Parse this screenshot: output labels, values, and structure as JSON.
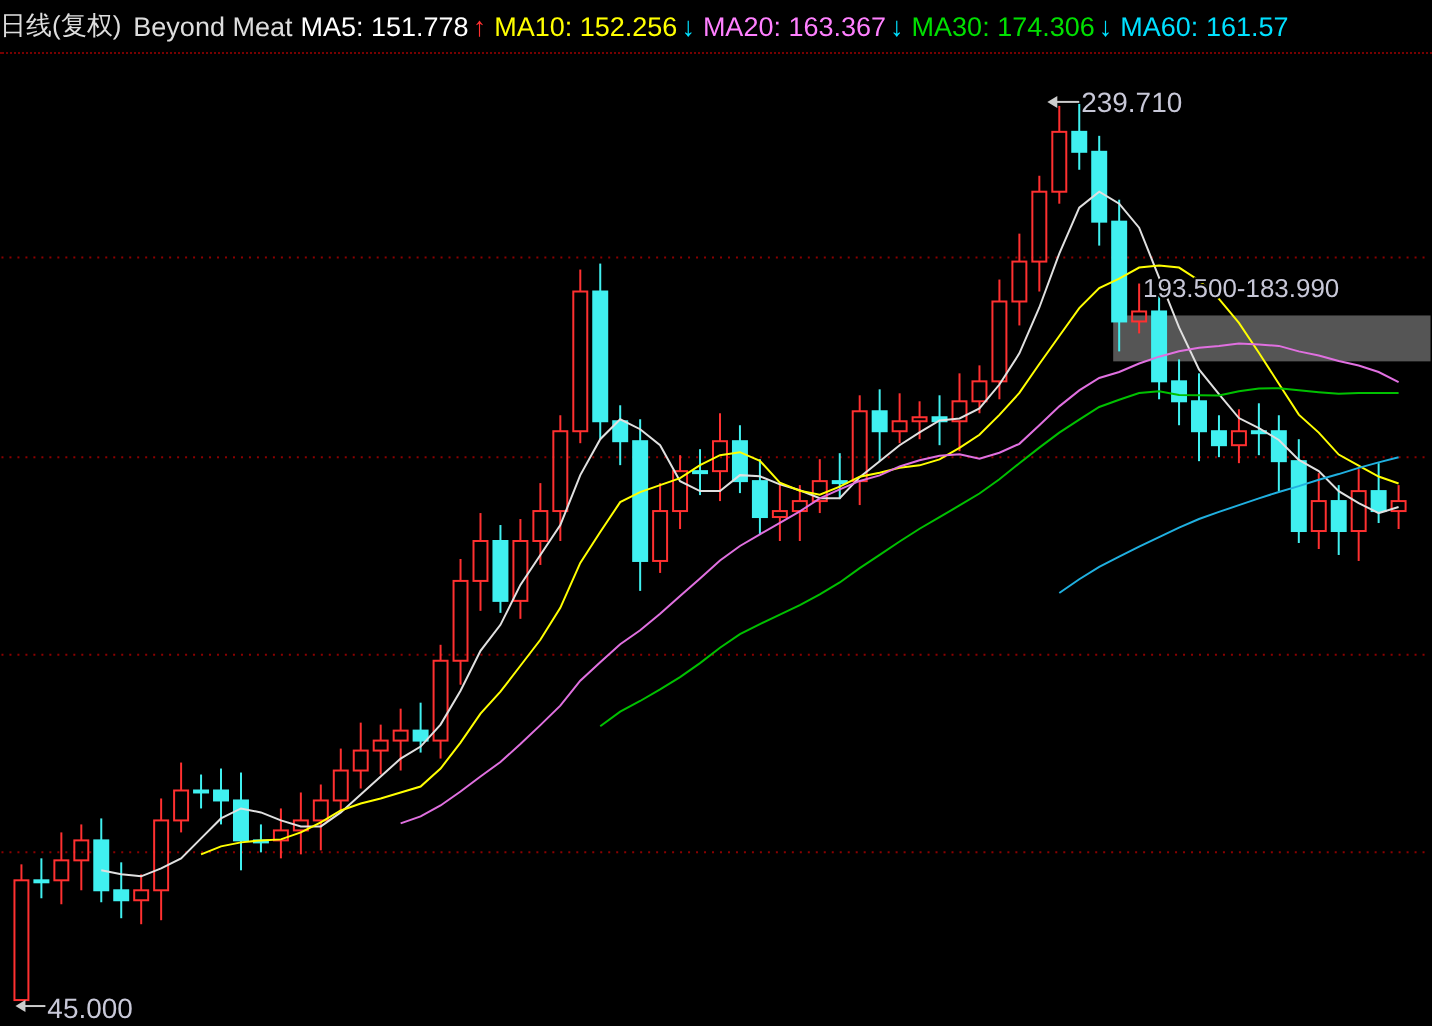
{
  "header": {
    "period": "日线(复权)",
    "name": "Beyond Meat",
    "indicators": [
      {
        "label": "MA5:",
        "value": "151.778",
        "rising": true,
        "arrow": "↑",
        "color": "#ffffff"
      },
      {
        "label": "MA10:",
        "value": "152.256",
        "rising": false,
        "arrow": "↓",
        "color": "#ffff00"
      },
      {
        "label": "MA20:",
        "value": "163.367",
        "rising": false,
        "arrow": "↓",
        "color": "#ff80ff"
      },
      {
        "label": "MA30:",
        "value": "174.306",
        "rising": false,
        "arrow": "↓",
        "color": "#00e000"
      },
      {
        "label": "MA60:",
        "value": "161.57",
        "color": "#00e0ff"
      }
    ]
  },
  "chart": {
    "high_label": "239.710",
    "range_label": "193.500-183.990",
    "low_label": "45.000"
  }
}
